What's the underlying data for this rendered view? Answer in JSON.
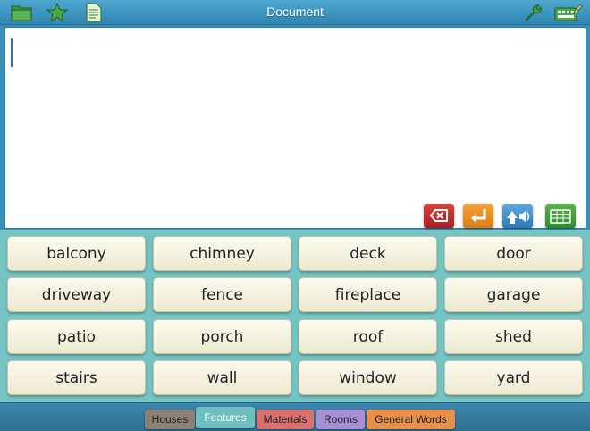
{
  "header": {
    "title": "Document"
  },
  "toolbar": {
    "left_icons": [
      "folder-icon",
      "star-icon",
      "document-icon"
    ],
    "right_icons": [
      "wrench-icon",
      "keyboard-edit-icon"
    ]
  },
  "document": {
    "text": ""
  },
  "actions": [
    "backspace-icon",
    "enter-icon",
    "speak-icon",
    "keyboard-icon"
  ],
  "words": [
    "balcony",
    "chimney",
    "deck",
    "door",
    "driveway",
    "fence",
    "fireplace",
    "garage",
    "patio",
    "porch",
    "roof",
    "shed",
    "stairs",
    "wall",
    "window",
    "yard"
  ],
  "tabs": [
    {
      "label": "Houses",
      "color": "#8c8176"
    },
    {
      "label": "Features",
      "color": "#6fbfbf",
      "selected": true
    },
    {
      "label": "Materials",
      "color": "#d9706d"
    },
    {
      "label": "Rooms",
      "color": "#a68fd6"
    },
    {
      "label": "General Words",
      "color": "#e8904a"
    }
  ]
}
